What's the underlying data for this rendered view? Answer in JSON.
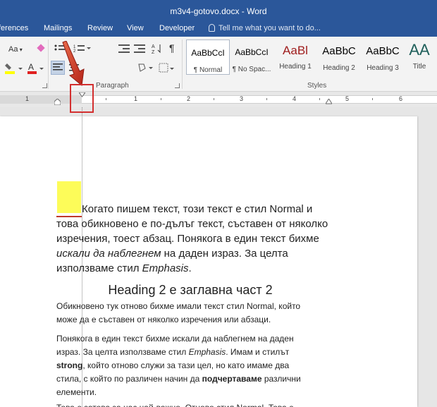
{
  "window": {
    "title": "m3v4-gotovo.docx - Word"
  },
  "tabs": [
    "ferences",
    "Mailings",
    "Review",
    "View",
    "Developer"
  ],
  "tell_me": "Tell me what you want to do...",
  "ribbon": {
    "font_size_label": "Aa",
    "paragraph_group": "Paragraph",
    "styles_group": "Styles",
    "styles": [
      {
        "sample": "AaBbCcI",
        "name": "¶ Normal"
      },
      {
        "sample": "AaBbCcI",
        "name": "¶ No Spac..."
      },
      {
        "sample": "AaBl",
        "name": "Heading 1"
      },
      {
        "sample": "AaBbC",
        "name": "Heading 2"
      },
      {
        "sample": "AaBbC",
        "name": "Heading 3"
      },
      {
        "sample": "AA",
        "name": "Title"
      }
    ]
  },
  "ruler": {
    "numbers": [
      "1",
      "1",
      "2",
      "3",
      "4",
      "5",
      "6"
    ]
  },
  "document": {
    "normal_lines": [
      "Когато пишем текст, този текст е стил Normal и",
      "това обикновено е по-дълъг текст, съставен от няколко",
      "изречения, тоест абзац. Понякога в един текст бихме"
    ],
    "normal_line4_italic": "искали да наблегнем",
    "normal_line4_rest": " на даден израз. За целта",
    "normal_line5_start": "използваме стил ",
    "normal_line5_italic": "Emphasis",
    "normal_line5_end": ".",
    "heading": "Heading 2 е заглавна част 2",
    "body1_lines": [
      "Обикновено тук отново бихме имали текст стил Normal, който",
      "може да е съставен от няколко изречения или абзаци."
    ],
    "body2_line1": "Понякога в един текст бихме искали да наблегнем на даден",
    "body2_line2_start": "израз. За целта използваме стил ",
    "body2_line2_italic": "Emphasis",
    "body2_line2_end": ". Имам и стилът",
    "body2_line3_bold": "strong",
    "body2_line3_rest": ", който отново служи за тази цел, но като имаме два",
    "body2_line4_start": "стила, с който по различен начин да ",
    "body2_line4_bold": "подчертаваме",
    "body2_line4_end": " различни",
    "body2_line5": "елементи.",
    "body3_partial": "Това е затова за нас най-важно. Отново стил Normal. Това е"
  },
  "colors": {
    "titlebar": "#2b579a",
    "highlight": "#fdfc59",
    "callout": "#d32f2f",
    "heading1": "#9e1b1b",
    "title_style": "#1e5f5a"
  }
}
